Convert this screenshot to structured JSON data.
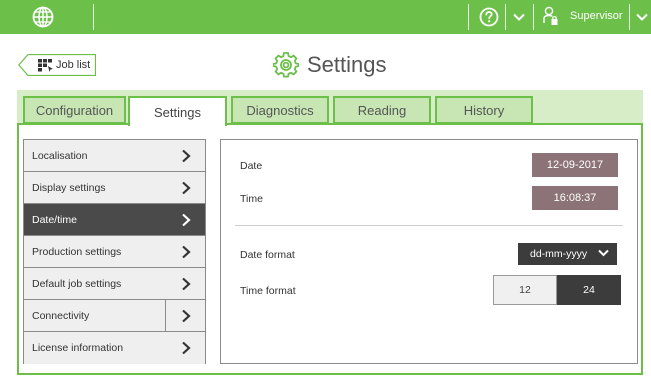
{
  "topbar": {
    "globe_icon": "globe-icon",
    "help_icon": "help-circle-icon",
    "user_icon": "user-key-icon",
    "user_name": "Supervisor",
    "bar_color": "#6cc04a"
  },
  "header": {
    "back_label": "Job list",
    "title": "Settings",
    "title_icon": "gear-icon"
  },
  "tabs": [
    {
      "label": "Configuration"
    },
    {
      "label": "Settings"
    },
    {
      "label": "Diagnostics"
    },
    {
      "label": "Reading"
    },
    {
      "label": "History"
    }
  ],
  "active_tab": "Settings",
  "menu": {
    "items": [
      {
        "label": "Localisation"
      },
      {
        "label": "Display settings"
      },
      {
        "label": "Date/time"
      },
      {
        "label": "Production settings"
      },
      {
        "label": "Default job settings"
      },
      {
        "label": "Connectivity"
      },
      {
        "label": "License information"
      }
    ],
    "active": "Date/time"
  },
  "content": {
    "date_label": "Date",
    "date_value": "12-09-2017",
    "time_label": "Time",
    "time_value": "16:08:37",
    "date_format_label": "Date format",
    "date_format_value": "dd-mm-yyyy",
    "time_format_label": "Time format",
    "time_format_options": [
      "12",
      "24"
    ],
    "time_format_selected": "24"
  },
  "colors": {
    "accent": "#6cc04a",
    "value_box": "#8c7377",
    "dark": "#3c3c3c"
  }
}
